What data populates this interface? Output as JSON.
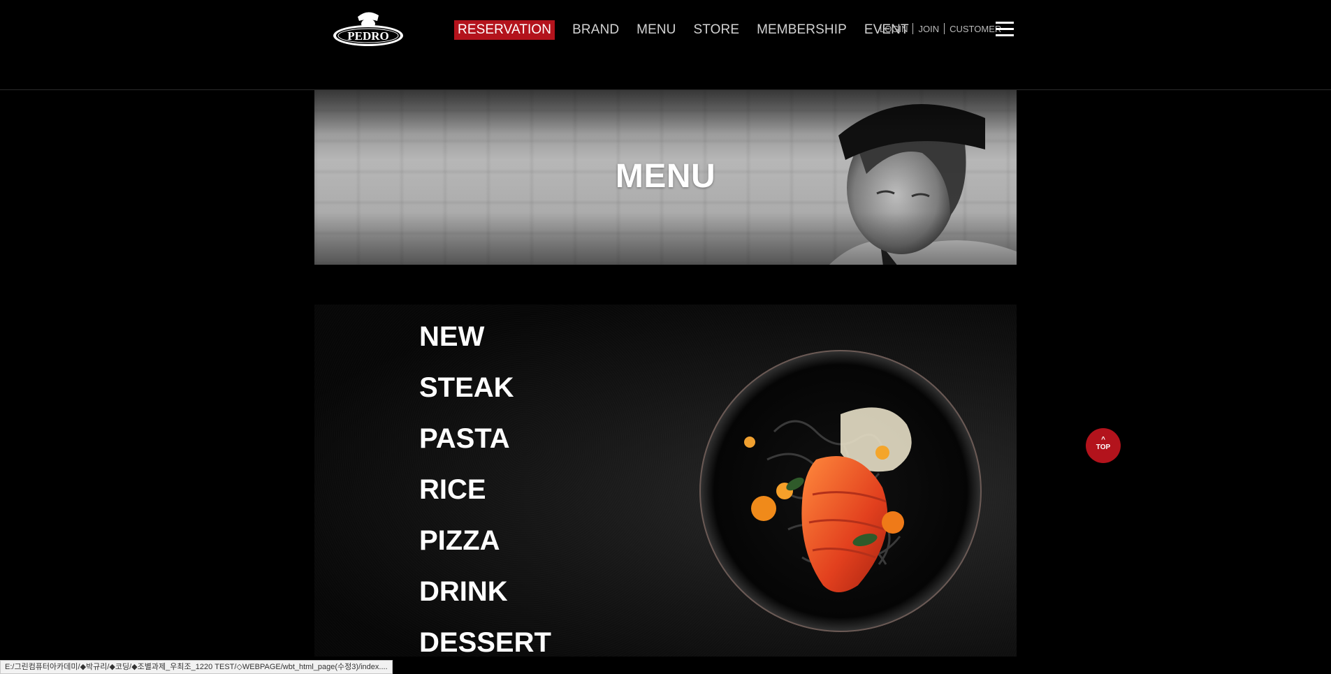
{
  "header": {
    "logo_text": "PEDRO",
    "nav": [
      {
        "label": "RESERVATION"
      },
      {
        "label": "BRAND"
      },
      {
        "label": "MENU"
      },
      {
        "label": "STORE"
      },
      {
        "label": "MEMBERSHIP"
      },
      {
        "label": "EVENT"
      }
    ],
    "util": {
      "login": "LOGIN",
      "join": "JOIN",
      "customer": "CUSTOMER"
    }
  },
  "hero": {
    "title": "MENU"
  },
  "menu": {
    "categories": [
      "NEW",
      "STEAK",
      "PASTA",
      "RICE",
      "PIZZA",
      "DRINK",
      "DESSERT"
    ]
  },
  "top_button": {
    "label": "TOP",
    "arrow": "^"
  },
  "status_bar": {
    "text": "E:/그린컴퓨터아카데미/◆박규리/◆코딩/◆조별과제_우최조_1220 TEST/◇WEBPAGE/wbt_html_page(수정3)/index...."
  },
  "colors": {
    "accent": "#b3131c",
    "background": "#000000",
    "nav_text": "#d2d2d2"
  },
  "icons": {
    "menu": "hamburger-icon",
    "logo": "pedro-logo",
    "top": "chevron-up-icon"
  }
}
